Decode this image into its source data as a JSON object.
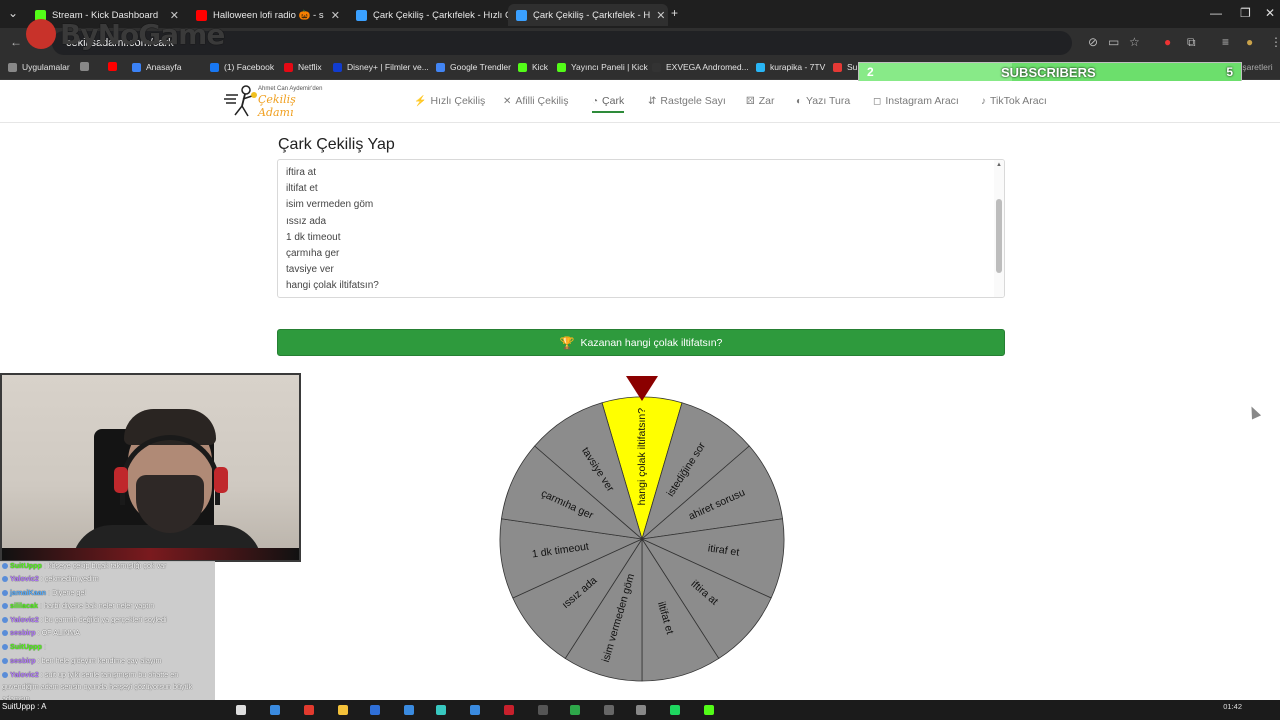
{
  "browser": {
    "tabs": [
      {
        "label": "Stream - Kick Dashboard",
        "color": "#53fc18",
        "active": false
      },
      {
        "label": "Halloween lofi radio 🎃 - s",
        "color": "#ff0000",
        "active": false
      },
      {
        "label": "Çark Çekiliş - Çarkıfelek - Hızlı Ç",
        "color": "#3aa0ff",
        "active": false
      },
      {
        "label": "Çark Çekiliş - Çarkıfelek - H",
        "color": "#3aa0ff",
        "active": true
      }
    ],
    "new_tab_label": "+",
    "address": "cekilisadami.com/cark",
    "overlay_logo": "ByNoGame",
    "bookmarks": [
      {
        "label": "Uygulamalar",
        "color": "#888888"
      },
      {
        "label": "",
        "color": "#888888"
      },
      {
        "label": "",
        "color": "#ff0000"
      },
      {
        "label": "Anasayfa",
        "color": "#3b82f6"
      },
      {
        "label": "(1) Facebook",
        "color": "#1877f2"
      },
      {
        "label": "Netflix",
        "color": "#e50914"
      },
      {
        "label": "Disney+ | Filmler ve...",
        "color": "#113ccf"
      },
      {
        "label": "Google Trendler",
        "color": "#4285f4"
      },
      {
        "label": "Kick",
        "color": "#53fc18"
      },
      {
        "label": "Yayıncı Paneli | Kick",
        "color": "#53fc18"
      },
      {
        "label": "EXVEGA Andromed...",
        "color": "#333333"
      },
      {
        "label": "kurapika - 7TV",
        "color": "#29b6f6"
      },
      {
        "label": "Su",
        "color": "#e53935"
      }
    ],
    "other_bookmarks": "Tüm Yer İşaretleri"
  },
  "subscriber_goal": {
    "current": "2",
    "label": "SUBSCRIBERS",
    "goal": "5",
    "progress": 0.4
  },
  "site": {
    "logo_small": "Ahmet Can Aydemir'den",
    "logo_big": "Çekiliş Adamı",
    "nav": [
      {
        "label": "Hızlı Çekiliş",
        "icon": "⚡",
        "active": false
      },
      {
        "label": "Afilli Çekiliş",
        "icon": "✕",
        "active": false
      },
      {
        "label": "Çark",
        "icon": "◔",
        "active": true
      },
      {
        "label": "Rastgele Sayı",
        "icon": "⇵",
        "active": false
      },
      {
        "label": "Zar",
        "icon": "⚄",
        "active": false
      },
      {
        "label": "Yazı Tura",
        "icon": "◐",
        "active": false
      },
      {
        "label": "Instagram Aracı",
        "icon": "◻",
        "active": false
      },
      {
        "label": "TikTok Aracı",
        "icon": "♪",
        "active": false
      }
    ]
  },
  "main": {
    "title": "Çark Çekiliş Yap",
    "entries": [
      "iftira at",
      "iltifat et",
      "isim vermeden göm",
      "ıssız ada",
      "1 dk timeout",
      "çarmıha ger",
      "tavsiye ver",
      "hangi çolak iltifatsın?"
    ],
    "winner_label": "Kazanan hangi çolak iltifatsın?"
  },
  "wheel": {
    "segments": [
      {
        "label": "hangi çolak iltifatsın?",
        "color": "#ffff00"
      },
      {
        "label": "istediğine sor",
        "color": "#8c8c8c"
      },
      {
        "label": "ahiret sorusu",
        "color": "#8c8c8c"
      },
      {
        "label": "itiraf et",
        "color": "#8c8c8c"
      },
      {
        "label": "iftira at",
        "color": "#8c8c8c"
      },
      {
        "label": "iltifat et",
        "color": "#8c8c8c"
      },
      {
        "label": "isim vermeden göm",
        "color": "#8c8c8c"
      },
      {
        "label": "ıssız ada",
        "color": "#8c8c8c"
      },
      {
        "label": "1 dk timeout",
        "color": "#8c8c8c"
      },
      {
        "label": "çarmıha ger",
        "color": "#8c8c8c"
      },
      {
        "label": "tavsiye ver",
        "color": "#8c8c8c"
      }
    ],
    "pointer_color": "#8b0000"
  },
  "chat": [
    {
      "user": "SuitUppp",
      "text": "köşeye çekip bıçak takmışlığı çok var",
      "color": "#53fc18"
    },
    {
      "user": "Yalovic2",
      "text": "çekmedim yedim",
      "color": "#b57cff"
    },
    {
      "user": "jamaiKaan",
      "text": "Diyene gel",
      "color": "#5ab0ff"
    },
    {
      "user": "sililacak",
      "text": "harbi diyene bak neler neler yaptın",
      "color": "#53fc18"
    },
    {
      "user": "Yalovic2",
      "text": "bu çarmıh değildi ya gerçekleri soyledi",
      "color": "#b57cff"
    },
    {
      "user": "sesbirp",
      "text": "OF ALINMA",
      "color": "#b57cff"
    },
    {
      "user": "SuitUppp",
      "text": "",
      "color": "#53fc18"
    },
    {
      "user": "sesbirp",
      "text": "ben hele gideyim kendime çay alayım",
      "color": "#b57cff"
    },
    {
      "user": "Yalovic2",
      "text": "suit up iyiki senle tanışmışım bu ohatte en guvendiğim adam sensin oyunda herşeyi çözüyorsun büyük adamsın",
      "color": "#b57cff"
    }
  ],
  "taskbar": {
    "chat_line": "SuitUppp : A",
    "time": "01:42",
    "date": ""
  }
}
